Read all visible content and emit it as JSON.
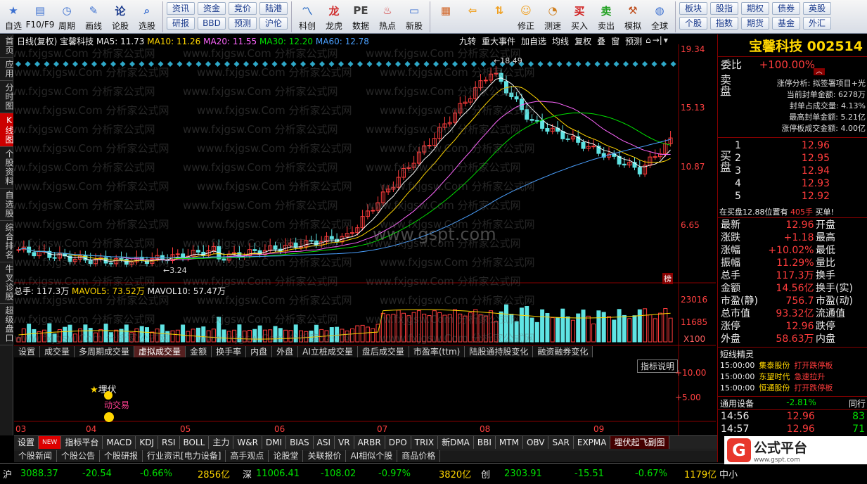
{
  "toolbar": {
    "items": [
      {
        "label": "自选",
        "icon": "star-icon"
      },
      {
        "label": "F10/F9",
        "icon": "f10-icon"
      },
      {
        "label": "周期",
        "icon": "clock-icon"
      },
      {
        "label": "画线",
        "icon": "pencil-icon"
      },
      {
        "label": "论股",
        "icon": "lun-icon"
      },
      {
        "label": "选股",
        "icon": "magnifier-icon"
      }
    ],
    "mini_col1": [
      "资讯",
      "研报"
    ],
    "mini_col2": [
      "资金",
      "BBD"
    ],
    "mini_col3": [
      "竞价",
      "预测"
    ],
    "mini_col4": [
      "陆港",
      "沪伦"
    ],
    "items2": [
      {
        "label": "科创",
        "icon": "chart-icon"
      },
      {
        "label": "龙虎",
        "icon": "tiger-icon"
      },
      {
        "label": "数据",
        "icon": "pe-icon"
      },
      {
        "label": "热点",
        "icon": "hot-icon"
      },
      {
        "label": "新股",
        "icon": "ipo-icon"
      }
    ],
    "items3": [
      {
        "label": "",
        "icon": "grid-icon"
      },
      {
        "label": "",
        "icon": "back-arrow-icon"
      },
      {
        "label": "",
        "icon": "updown-icon"
      },
      {
        "label": "修正",
        "icon": "wrench-icon"
      },
      {
        "label": "测速",
        "icon": "speed-icon"
      },
      {
        "label": "买入",
        "icon": "buy-icon"
      },
      {
        "label": "卖出",
        "icon": "sell-icon"
      },
      {
        "label": "模拟",
        "icon": "hammer-icon"
      },
      {
        "label": "全球",
        "icon": "globe-icon"
      }
    ],
    "mini_right1": [
      "板块",
      "个股"
    ],
    "mini_right2": [
      "股指",
      "指数"
    ],
    "mini_right3": [
      "期权",
      "期货"
    ],
    "mini_right4": [
      "债券",
      "基金"
    ],
    "mini_right5": [
      "英股",
      "外汇"
    ]
  },
  "left_tabs": [
    "首页",
    "应用",
    "分时图",
    "K线图",
    "个股资料",
    "自选股",
    "综合排名",
    "牛叉诊股",
    "超级盘口"
  ],
  "chart": {
    "header": "日线(复权) 宝馨科技",
    "ma5": "MA5: 11.73",
    "ma10": "MA10: 11.26",
    "ma20": "MA20: 11.55",
    "ma30": "MA30: 12.20",
    "ma60": "MA60: 12.78",
    "top_buttons": [
      "九转",
      "重大事件",
      "加自选",
      "均线",
      "复权",
      "叠",
      "窗",
      "预测"
    ],
    "price_axis": [
      "19.34",
      "15.13",
      "10.87",
      "6.65"
    ],
    "high_label": "18.49",
    "low_label": "3.24",
    "bang": "榜",
    "vol_header": "总手: 117.3万",
    "mavol5": "MAVOL5: 73.52万",
    "mavol10": "MAVOL10: 57.47万",
    "vol_axis": [
      "23016",
      "11685",
      "X100"
    ],
    "ind_tabs": [
      "设置",
      "成交量",
      "多周期成交量",
      "虚拟成交量",
      "金额",
      "换手率",
      "内盘",
      "外盘",
      "AI立桩成交量",
      "盘后成交量",
      "市盈率(ttm)",
      "陆股通持股变化",
      "融资融券变化"
    ],
    "ind_btn": "指标说明",
    "ind_axis": [
      "+10.00",
      "+5.00"
    ],
    "signal1": "埋伏",
    "signal2": "动交易",
    "months": [
      "03",
      "04",
      "05",
      "06",
      "07",
      "08",
      "09"
    ],
    "watermark": "www.fxjgsw.Com 分析家公式网",
    "watermark2": "www.gspt.com"
  },
  "chart_data": {
    "type": "candlestick",
    "title": "宝馨科技 002514 日线(复权)",
    "high": 18.49,
    "low": 3.24,
    "ylim": [
      3.24,
      19.34
    ],
    "ma": {
      "MA5": 11.73,
      "MA10": 11.26,
      "MA20": 11.55,
      "MA30": 12.2,
      "MA60": 12.78
    },
    "volume": {
      "total": "117.3万",
      "MAVOL5": "73.52万",
      "MAVOL10": "57.47万"
    }
  },
  "bottom_tabs": [
    "设置",
    "NEW",
    "指标平台",
    "MACD",
    "KDJ",
    "RSI",
    "BOLL",
    "主力",
    "W&R",
    "DMI",
    "BIAS",
    "ASI",
    "VR",
    "ARBR",
    "DPO",
    "TRIX",
    "新DMA",
    "BBI",
    "MTM",
    "OBV",
    "SAR",
    "EXPMA",
    "埋伏起飞副图"
  ],
  "bottom_tabs2": [
    "个股新闻",
    "个股公告",
    "个股研报",
    "行业资讯[电力设备]",
    "高手观点",
    "论股堂",
    "关联报价",
    "AI相似个股",
    "商品价格"
  ],
  "panel": {
    "title": "宝馨科技 002514",
    "weibi_label": "委比",
    "weibi": "+100.00%",
    "analysis": [
      "涨停分析: 拟签署项目+光",
      "当前封单金额: 6278万",
      "封单占成交量: 4.13%",
      "最高封单金额: 5.21亿",
      "涨停板成交金额: 4.00亿"
    ],
    "sell_label": "卖盘",
    "buy_label": "买盘",
    "buy": [
      {
        "n": "1",
        "p": "12.96"
      },
      {
        "n": "2",
        "p": "12.95"
      },
      {
        "n": "3",
        "p": "12.94"
      },
      {
        "n": "4",
        "p": "12.93"
      },
      {
        "n": "5",
        "p": "12.92"
      }
    ],
    "queue": "在买盘12.88位置有",
    "queue_qty": "405手",
    "queue_tag": "买单!",
    "stats": [
      {
        "k": "最新",
        "v": "12.96",
        "k2": "开盘"
      },
      {
        "k": "涨跌",
        "v": "+1.18",
        "k2": "最高"
      },
      {
        "k": "涨幅",
        "v": "+10.02%",
        "k2": "最低"
      },
      {
        "k": "振幅",
        "v": "11.29%",
        "k2": "量比"
      },
      {
        "k": "总手",
        "v": "117.3万",
        "k2": "换手"
      },
      {
        "k": "金额",
        "v": "14.56亿",
        "k2": "换手(实)"
      },
      {
        "k": "市盈(静)",
        "v": "756.7",
        "k2": "市盈(动)"
      },
      {
        "k": "总市值",
        "v": "93.32亿",
        "k2": "流通值"
      },
      {
        "k": "涨停",
        "v": "12.96",
        "k2": "跌停"
      },
      {
        "k": "外盘",
        "v": "58.63万",
        "k2": "内盘"
      }
    ],
    "news_title": "短线精灵",
    "news": [
      {
        "t": "15:00:00",
        "s": "集泰股份",
        "e": "打开跌停板"
      },
      {
        "t": "15:00:00",
        "s": "东望时代",
        "e": "急速拉升"
      },
      {
        "t": "15:00:00",
        "s": "恒通股份",
        "e": "打开跌停板"
      }
    ],
    "sector": "通用设备",
    "sector_pct": "-2.81%",
    "sector_right": "同行",
    "ticks": [
      {
        "t": "14:56",
        "p": "12.96",
        "v": "83"
      },
      {
        "t": "14:57",
        "p": "12.96",
        "v": "71"
      }
    ]
  },
  "status": {
    "sh_label": "沪",
    "sh": "3088.37",
    "sh_chg": "-20.54",
    "sh_pct": "-0.66%",
    "sh_amt": "2856亿",
    "sz_label": "深",
    "sz": "11006.41",
    "sz_chg": "-108.02",
    "sz_pct": "-0.97%",
    "sz_amt": "3820亿",
    "cy_label": "创",
    "cy": "2303.91",
    "cy_chg": "-15.51",
    "cy_pct": "-0.67%",
    "cy_amt": "1179亿",
    "right": "中小"
  },
  "logo": "公式平台",
  "logo_sub": "www.gspt.com"
}
